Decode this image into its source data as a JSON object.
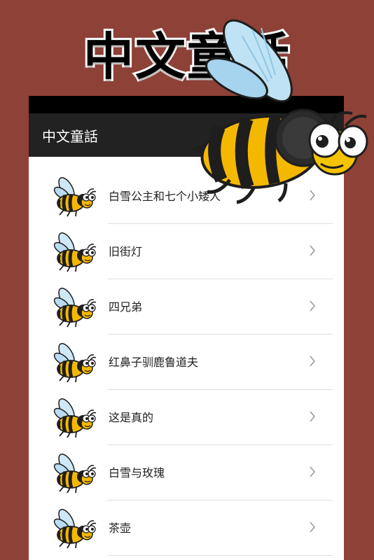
{
  "promo": {
    "title": "中文童話"
  },
  "app_bar": {
    "title": "中文童話"
  },
  "stories": [
    {
      "title": "白雪公主和七个小矮人"
    },
    {
      "title": "旧街灯"
    },
    {
      "title": "四兄弟"
    },
    {
      "title": "红鼻子驯鹿鲁道夫"
    },
    {
      "title": "这是真的"
    },
    {
      "title": "白雪与玫瑰"
    },
    {
      "title": "茶壶"
    }
  ],
  "colors": {
    "background": "#8e4137",
    "app_bar": "#222222",
    "bee_yellow": "#f5b800",
    "bee_black": "#1e1e1e"
  },
  "icons": {
    "list_item": "bee-icon",
    "row_arrow": "chevron-right-icon",
    "mascot": "bee-mascot"
  }
}
